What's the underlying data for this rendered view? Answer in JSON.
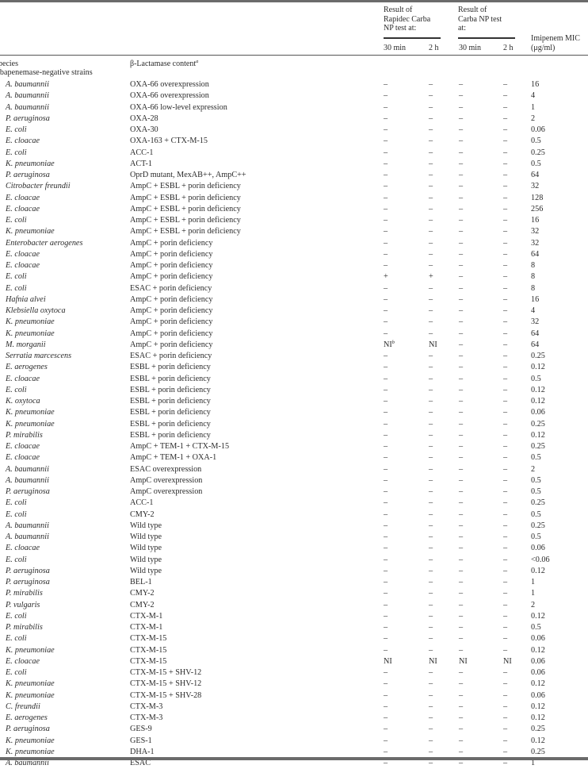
{
  "table": {
    "headers": {
      "species": "pecies",
      "content": "β-Lactamase content",
      "content_footnote": "a",
      "rapidec_group": [
        "Result of",
        "Rapidec Carba",
        "NP test at:"
      ],
      "carba_group": [
        "Result of",
        "Carba NP test",
        "at:"
      ],
      "rapidec_30": "30 min",
      "rapidec_2h": "2 h",
      "carba_30": "30 min",
      "carba_2h": "2 h",
      "mic": [
        "Imipenem MIC",
        "(μg/ml)"
      ]
    },
    "section_label": "arbapenemase-negative strains",
    "rows": [
      {
        "species": "A. baumannii",
        "content": "OXA-66 overexpression",
        "r30": "–",
        "r2h": "–",
        "c30": "–",
        "c2h": "–",
        "mic": "16"
      },
      {
        "species": "A. baumannii",
        "content": "OXA-66 overexpression",
        "r30": "–",
        "r2h": "–",
        "c30": "–",
        "c2h": "–",
        "mic": "4"
      },
      {
        "species": "A. baumannii",
        "content": "OXA-66 low-level expression",
        "r30": "–",
        "r2h": "–",
        "c30": "–",
        "c2h": "–",
        "mic": "1"
      },
      {
        "species": "P. aeruginosa",
        "content": "OXA-28",
        "r30": "–",
        "r2h": "–",
        "c30": "–",
        "c2h": "–",
        "mic": "2"
      },
      {
        "species": "E. coli",
        "content": "OXA-30",
        "r30": "–",
        "r2h": "–",
        "c30": "–",
        "c2h": "–",
        "mic": "0.06"
      },
      {
        "species": "E. cloacae",
        "content": "OXA-163 + CTX-M-15",
        "r30": "–",
        "r2h": "–",
        "c30": "–",
        "c2h": "–",
        "mic": "0.5"
      },
      {
        "species": "E. coli",
        "content": "ACC-1",
        "r30": "–",
        "r2h": "–",
        "c30": "–",
        "c2h": "–",
        "mic": "0.25"
      },
      {
        "species": "K. pneumoniae",
        "content": "ACT-1",
        "r30": "–",
        "r2h": "–",
        "c30": "–",
        "c2h": "–",
        "mic": "0.5"
      },
      {
        "species": "P. aeruginosa",
        "content": "OprD mutant, MexAB++, AmpC++",
        "r30": "–",
        "r2h": "–",
        "c30": "–",
        "c2h": "–",
        "mic": "64"
      },
      {
        "species": "Citrobacter freundii",
        "content": "AmpC + ESBL + porin deficiency",
        "r30": "–",
        "r2h": "–",
        "c30": "–",
        "c2h": "–",
        "mic": "32"
      },
      {
        "species": "E. cloacae",
        "content": "AmpC + ESBL + porin deficiency",
        "r30": "–",
        "r2h": "–",
        "c30": "–",
        "c2h": "–",
        "mic": "128"
      },
      {
        "species": "E. cloacae",
        "content": "AmpC + ESBL + porin deficiency",
        "r30": "–",
        "r2h": "–",
        "c30": "–",
        "c2h": "–",
        "mic": "256"
      },
      {
        "species": "E. coli",
        "content": "AmpC + ESBL + porin deficiency",
        "r30": "–",
        "r2h": "–",
        "c30": "–",
        "c2h": "–",
        "mic": "16"
      },
      {
        "species": "K. pneumoniae",
        "content": "AmpC + ESBL + porin deficiency",
        "r30": "–",
        "r2h": "–",
        "c30": "–",
        "c2h": "–",
        "mic": "32"
      },
      {
        "species": "Enterobacter aerogenes",
        "content": "AmpC + porin deficiency",
        "r30": "–",
        "r2h": "–",
        "c30": "–",
        "c2h": "–",
        "mic": "32"
      },
      {
        "species": "E. cloacae",
        "content": "AmpC + porin deficiency",
        "r30": "–",
        "r2h": "–",
        "c30": "–",
        "c2h": "–",
        "mic": "64"
      },
      {
        "species": "E. cloacae",
        "content": "AmpC + porin deficiency",
        "r30": "–",
        "r2h": "–",
        "c30": "–",
        "c2h": "–",
        "mic": "8"
      },
      {
        "species": "E. coli",
        "content": "AmpC + porin deficiency",
        "r30": "+",
        "r2h": "+",
        "c30": "–",
        "c2h": "–",
        "mic": "8"
      },
      {
        "species": "E. coli",
        "content": "ESAC + porin deficiency",
        "r30": "–",
        "r2h": "–",
        "c30": "–",
        "c2h": "–",
        "mic": "8"
      },
      {
        "species": "Hafnia alvei",
        "content": "AmpC + porin deficiency",
        "r30": "–",
        "r2h": "–",
        "c30": "–",
        "c2h": "–",
        "mic": "16"
      },
      {
        "species": "Klebsiella oxytoca",
        "content": "AmpC + porin deficiency",
        "r30": "–",
        "r2h": "–",
        "c30": "–",
        "c2h": "–",
        "mic": "4"
      },
      {
        "species": "K. pneumoniae",
        "content": "AmpC + porin deficiency",
        "r30": "–",
        "r2h": "–",
        "c30": "–",
        "c2h": "–",
        "mic": "32"
      },
      {
        "species": "K. pneumoniae",
        "content": "AmpC + porin deficiency",
        "r30": "–",
        "r2h": "–",
        "c30": "–",
        "c2h": "–",
        "mic": "64"
      },
      {
        "species": "M. morganii",
        "content": "AmpC + porin deficiency",
        "r30": "NI",
        "r30_sup": "b",
        "r2h": "NI",
        "c30": "–",
        "c2h": "–",
        "mic": "64"
      },
      {
        "species": "Serratia marcescens",
        "content": "ESAC + porin deficiency",
        "r30": "–",
        "r2h": "–",
        "c30": "–",
        "c2h": "–",
        "mic": "0.25"
      },
      {
        "species": "E. aerogenes",
        "content": "ESBL + porin deficiency",
        "r30": "–",
        "r2h": "–",
        "c30": "–",
        "c2h": "–",
        "mic": "0.12"
      },
      {
        "species": "E. cloacae",
        "content": "ESBL + porin deficiency",
        "r30": "–",
        "r2h": "–",
        "c30": "–",
        "c2h": "–",
        "mic": "0.5"
      },
      {
        "species": "E. coli",
        "content": "ESBL + porin deficiency",
        "r30": "–",
        "r2h": "–",
        "c30": "–",
        "c2h": "–",
        "mic": "0.12"
      },
      {
        "species": "K. oxytoca",
        "content": "ESBL + porin deficiency",
        "r30": "–",
        "r2h": "–",
        "c30": "–",
        "c2h": "–",
        "mic": "0.12"
      },
      {
        "species": "K. pneumoniae",
        "content": "ESBL + porin deficiency",
        "r30": "–",
        "r2h": "–",
        "c30": "–",
        "c2h": "–",
        "mic": "0.06"
      },
      {
        "species": "K. pneumoniae",
        "content": "ESBL + porin deficiency",
        "r30": "–",
        "r2h": "–",
        "c30": "–",
        "c2h": "–",
        "mic": "0.25"
      },
      {
        "species": "P. mirabilis",
        "content": "ESBL + porin deficiency",
        "r30": "–",
        "r2h": "–",
        "c30": "–",
        "c2h": "–",
        "mic": "0.12"
      },
      {
        "species": "E. cloacae",
        "content": "AmpC + TEM-1 + CTX-M-15",
        "r30": "–",
        "r2h": "–",
        "c30": "–",
        "c2h": "–",
        "mic": "0.25"
      },
      {
        "species": "E. cloacae",
        "content": "AmpC + TEM-1 + OXA-1",
        "r30": "–",
        "r2h": "–",
        "c30": "–",
        "c2h": "–",
        "mic": "0.5"
      },
      {
        "species": "A. baumannii",
        "content": "ESAC overexpression",
        "r30": "–",
        "r2h": "–",
        "c30": "–",
        "c2h": "–",
        "mic": "2"
      },
      {
        "species": "A. baumannii",
        "content": "AmpC overexpression",
        "r30": "–",
        "r2h": "–",
        "c30": "–",
        "c2h": "–",
        "mic": "0.5"
      },
      {
        "species": "P. aeruginosa",
        "content": "AmpC overexpression",
        "r30": "–",
        "r2h": "–",
        "c30": "–",
        "c2h": "–",
        "mic": "0.5"
      },
      {
        "species": "E. coli",
        "content": "ACC-1",
        "r30": "–",
        "r2h": "–",
        "c30": "–",
        "c2h": "–",
        "mic": "0.25"
      },
      {
        "species": "E. coli",
        "content": "CMY-2",
        "r30": "–",
        "r2h": "–",
        "c30": "–",
        "c2h": "–",
        "mic": "0.5"
      },
      {
        "species": "A. baumannii",
        "content": "Wild type",
        "r30": "–",
        "r2h": "–",
        "c30": "–",
        "c2h": "–",
        "mic": "0.25"
      },
      {
        "species": "A. baumannii",
        "content": "Wild type",
        "r30": "–",
        "r2h": "–",
        "c30": "–",
        "c2h": "–",
        "mic": "0.5"
      },
      {
        "species": "E. cloacae",
        "content": "Wild type",
        "r30": "–",
        "r2h": "–",
        "c30": "–",
        "c2h": "–",
        "mic": "0.06"
      },
      {
        "species": "E. coli",
        "content": "Wild type",
        "r30": "–",
        "r2h": "–",
        "c30": "–",
        "c2h": "–",
        "mic": "<0.06"
      },
      {
        "species": "P. aeruginosa",
        "content": "Wild type",
        "r30": "–",
        "r2h": "–",
        "c30": "–",
        "c2h": "–",
        "mic": "0.12"
      },
      {
        "species": "P. aeruginosa",
        "content": "BEL-1",
        "r30": "–",
        "r2h": "–",
        "c30": "–",
        "c2h": "–",
        "mic": "1"
      },
      {
        "species": "P. mirabilis",
        "content": "CMY-2",
        "r30": "–",
        "r2h": "–",
        "c30": "–",
        "c2h": "–",
        "mic": "1"
      },
      {
        "species": "P. vulgaris",
        "content": "CMY-2",
        "r30": "–",
        "r2h": "–",
        "c30": "–",
        "c2h": "–",
        "mic": "2"
      },
      {
        "species": "E. coli",
        "content": "CTX-M-1",
        "r30": "–",
        "r2h": "–",
        "c30": "–",
        "c2h": "–",
        "mic": "0.12"
      },
      {
        "species": "P. mirabilis",
        "content": "CTX-M-1",
        "r30": "–",
        "r2h": "–",
        "c30": "–",
        "c2h": "–",
        "mic": "0.5"
      },
      {
        "species": "E. coli",
        "content": "CTX-M-15",
        "r30": "–",
        "r2h": "–",
        "c30": "–",
        "c2h": "–",
        "mic": "0.06"
      },
      {
        "species": "K. pneumoniae",
        "content": "CTX-M-15",
        "r30": "–",
        "r2h": "–",
        "c30": "–",
        "c2h": "–",
        "mic": "0.12"
      },
      {
        "species": "E. cloacae",
        "content": "CTX-M-15",
        "r30": "NI",
        "r2h": "NI",
        "c30": "NI",
        "c2h": "NI",
        "mic": "0.06"
      },
      {
        "species": "E. coli",
        "content": "CTX-M-15 + SHV-12",
        "r30": "–",
        "r2h": "–",
        "c30": "–",
        "c2h": "–",
        "mic": "0.06"
      },
      {
        "species": "K. pneumoniae",
        "content": "CTX-M-15 + SHV-12",
        "r30": "–",
        "r2h": "–",
        "c30": "–",
        "c2h": "–",
        "mic": "0.12"
      },
      {
        "species": "K. pneumoniae",
        "content": "CTX-M-15 + SHV-28",
        "r30": "–",
        "r2h": "–",
        "c30": "–",
        "c2h": "–",
        "mic": "0.06"
      },
      {
        "species": "C. freundii",
        "content": "CTX-M-3",
        "r30": "–",
        "r2h": "–",
        "c30": "–",
        "c2h": "–",
        "mic": "0.12"
      },
      {
        "species": "E. aerogenes",
        "content": "CTX-M-3",
        "r30": "–",
        "r2h": "–",
        "c30": "–",
        "c2h": "–",
        "mic": "0.12"
      },
      {
        "species": "P. aeruginosa",
        "content": "GES-9",
        "r30": "–",
        "r2h": "–",
        "c30": "–",
        "c2h": "–",
        "mic": "0.25"
      },
      {
        "species": "K. pneumoniae",
        "content": "GES-1",
        "r30": "–",
        "r2h": "–",
        "c30": "–",
        "c2h": "–",
        "mic": "0.12"
      },
      {
        "species": "K. pneumoniae",
        "content": "DHA-1",
        "r30": "–",
        "r2h": "–",
        "c30": "–",
        "c2h": "–",
        "mic": "0.25"
      },
      {
        "species": "A. baumannii",
        "content": "ESAC",
        "r30": "–",
        "r2h": "–",
        "c30": "–",
        "c2h": "–",
        "mic": "1"
      }
    ]
  }
}
